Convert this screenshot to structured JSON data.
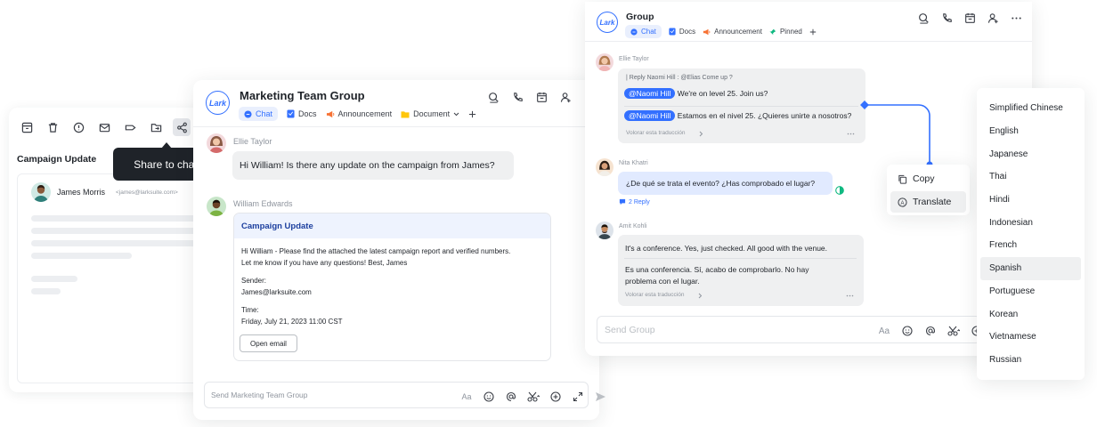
{
  "mail": {
    "tooltip": "Share to chat",
    "subject": "Campaign Update",
    "sender_name": "James Morris",
    "sender_email": "<james@larksuite.com>"
  },
  "marketing": {
    "logo": "Lark",
    "title": "Marketing Team Group",
    "tabs": {
      "chat": "Chat",
      "docs": "Docs",
      "announcement": "Announcement",
      "document": "Document"
    },
    "msg1": {
      "sender": "Ellie Taylor",
      "text": "Hi William! Is there any update on the campaign from James?"
    },
    "msg2": {
      "sender": "William Edwards",
      "card_title": "Campaign Update",
      "body_line1": "Hi William - Please find the attached the latest campaign report and verified numbers.",
      "body_line2": "Let me know if you have any questions! Best, James",
      "sender_label": "Sender:",
      "sender_value": "James@larksuite.com",
      "time_label": "Time:",
      "time_value": "Friday, July 21, 2023 11:00 CST",
      "button": "Open email"
    },
    "input_placeholder": "Send Marketing Team Group"
  },
  "group": {
    "logo": "Lark",
    "title": "Group",
    "tabs": {
      "chat": "Chat",
      "docs": "Docs",
      "announcement": "Announcement",
      "pinned": "Pinned"
    },
    "msg1": {
      "sender": "Ellie Taylor",
      "reply_line": "| Reply Naomi Hill : @Elias Come up ?",
      "mention": "@Naomi Hill",
      "text_en": "We're on level 25. Join us?",
      "text_es": "Estamos en el nivel 25. ¿Quieres unirte a nosotros?",
      "translate_link": "Volorar esta traducción"
    },
    "msg2": {
      "sender": "Nita Khatri",
      "text": "¿De qué se trata el evento? ¿Has comprobado el lugar?",
      "replies": "2 Reply"
    },
    "msg3": {
      "sender": "Amit Kohli",
      "text_en": "It's a conference. Yes, just checked. All good with the venue.",
      "text_es_line1": "Es una conferencia. Sí, acabo de comprobarlo. No hay",
      "text_es_line2": "problema con el lugar.",
      "translate_link": "Volorar esta traducción"
    },
    "input_placeholder": "Send Group"
  },
  "context_menu": {
    "copy": "Copy",
    "translate": "Translate"
  },
  "languages": [
    "Simplified Chinese",
    "English",
    "Japanese",
    "Thai",
    "Hindi",
    "Indonesian",
    "French",
    "Spanish",
    "Portuguese",
    "Korean",
    "Vietnamese",
    "Russian"
  ],
  "selected_language": "Spanish",
  "colors": {
    "accent": "#3370ff",
    "tooltip_bg": "#1f2329",
    "bubble_bg": "#eff0f1",
    "reaction_green": "#10b981"
  }
}
